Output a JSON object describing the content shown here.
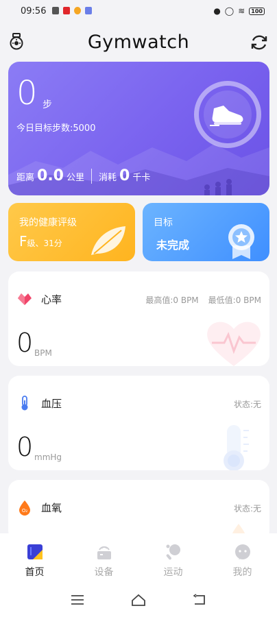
{
  "status_bar": {
    "time": "09:56",
    "battery": "100"
  },
  "header": {
    "title": "Gymwatch"
  },
  "steps": {
    "count": "0",
    "unit": "步",
    "target_text": "今日目标步数:5000",
    "distance_label": "距离",
    "distance_value": "0.0",
    "distance_unit": "公里",
    "calorie_label": "消耗",
    "calorie_value": "0",
    "calorie_unit": "千卡"
  },
  "health_rating": {
    "title": "我的健康评级",
    "grade": "F",
    "detail": "级、31分"
  },
  "goal": {
    "title": "目标",
    "status": "未完成"
  },
  "heart_rate": {
    "name": "心率",
    "max_text": "最高值:0 BPM",
    "min_text": "最低值:0 BPM",
    "value": "0",
    "unit": "BPM"
  },
  "blood_pressure": {
    "name": "血压",
    "status_text": "状态:无",
    "value": "0",
    "unit": "mmHg"
  },
  "blood_oxygen": {
    "name": "血氧",
    "status_text": "状态:无"
  },
  "bottom_nav": {
    "items": [
      {
        "label": "首页",
        "icon": "home-icon"
      },
      {
        "label": "设备",
        "icon": "device-icon"
      },
      {
        "label": "运动",
        "icon": "sport-icon"
      },
      {
        "label": "我的",
        "icon": "profile-icon"
      }
    ],
    "active_index": 0
  },
  "colors": {
    "steps_card": "#7a63ef",
    "health_card": "#ffb41f",
    "goal_card": "#3f8fff",
    "heart_accent": "#f0456a",
    "pressure_accent": "#4a7cf0",
    "oxygen_accent": "#ff7a1a"
  }
}
